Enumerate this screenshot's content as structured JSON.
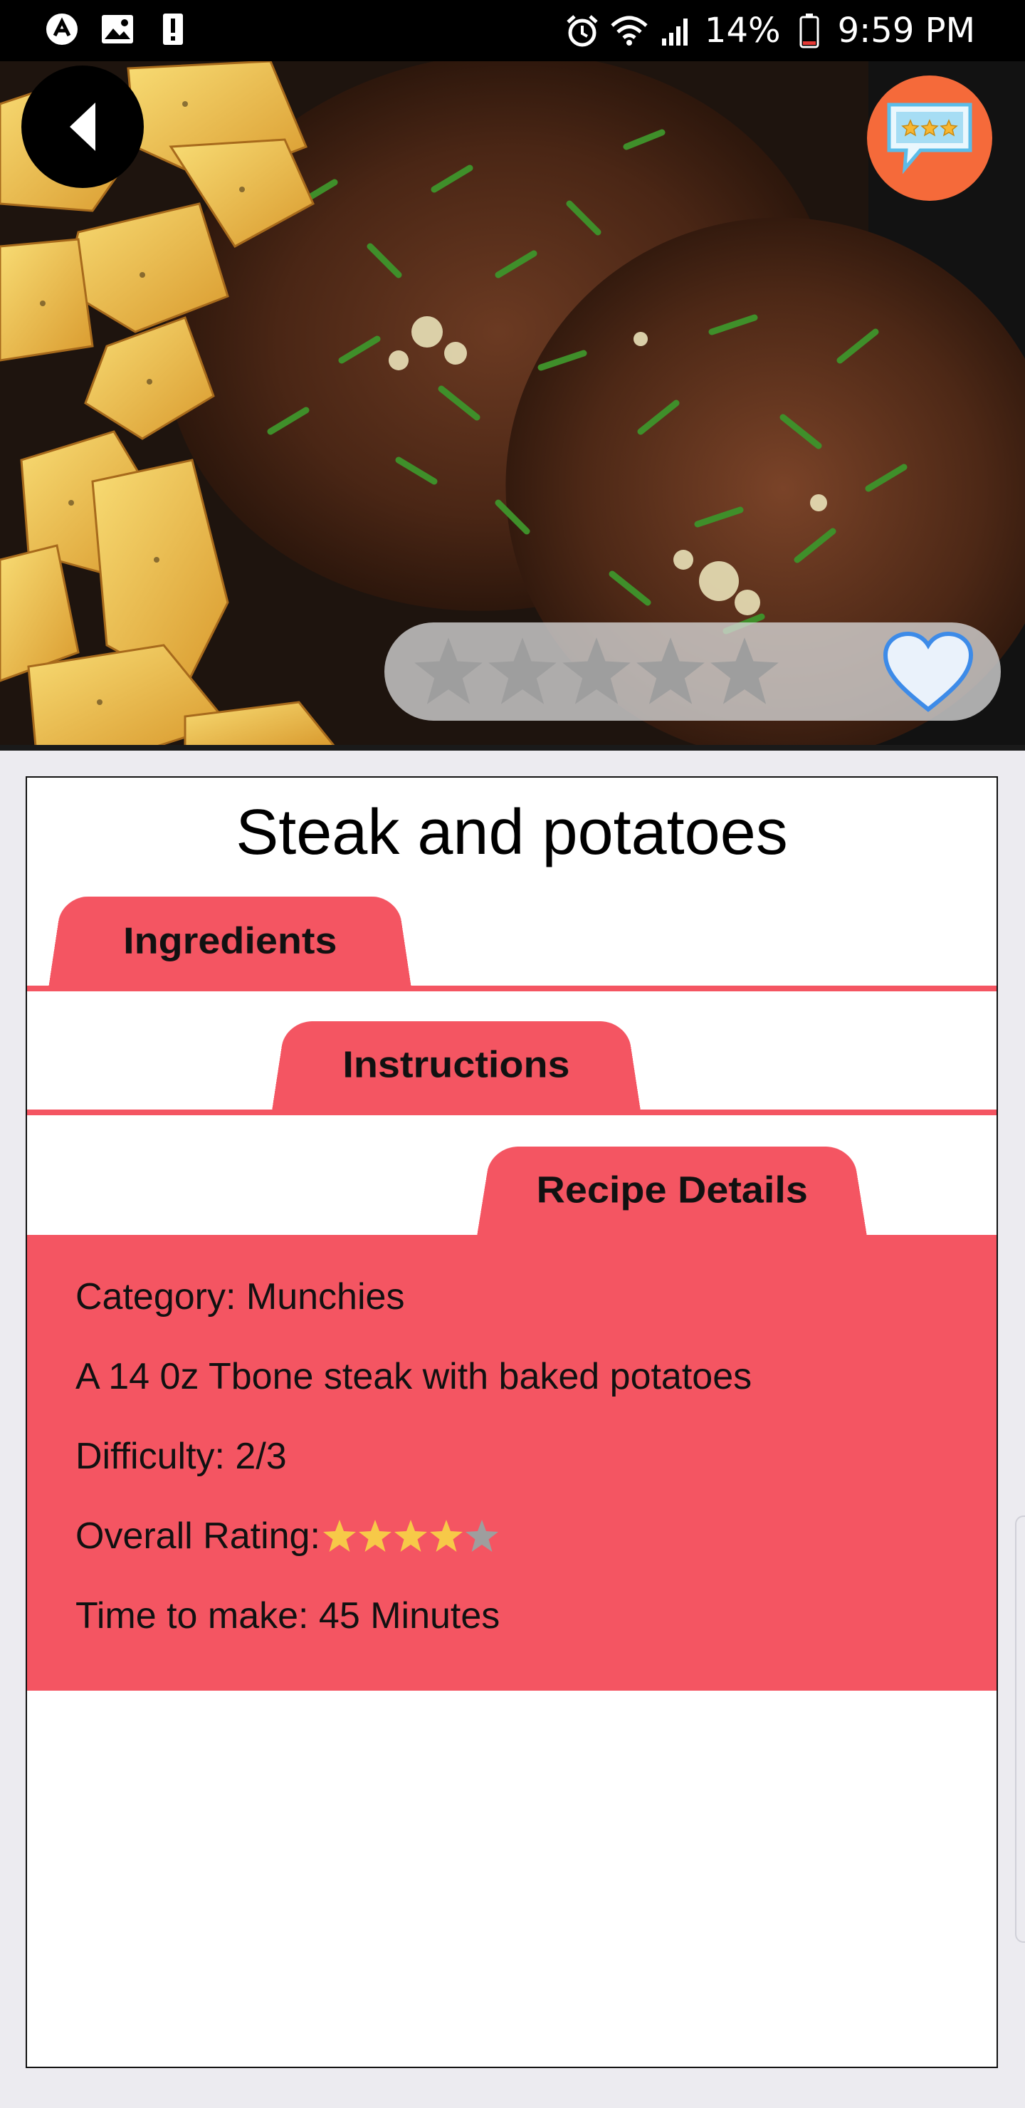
{
  "status_bar": {
    "left_icons": [
      "app-notification-icon",
      "image-notification-icon",
      "alert-notification-icon"
    ],
    "right_icons": [
      "alarm-icon",
      "wifi-icon",
      "signal-icon"
    ],
    "battery": "14%",
    "time": "9:59 PM"
  },
  "hero": {
    "image": "steak-and-potatoes-photo",
    "back_icon": "back-arrow-icon",
    "review_icon": "rating-review-icon",
    "user_rating": {
      "filled": 0,
      "total": 5
    },
    "favorite_icon": "heart-icon"
  },
  "recipe": {
    "title": "Steak and potatoes"
  },
  "tabs": {
    "ingredients": "Ingredients",
    "instructions": "Instructions",
    "details": "Recipe Details"
  },
  "details": {
    "category": "Category: Munchies",
    "description": "A 14 0z Tbone steak with baked potatoes",
    "difficulty": "Difficulty: 2/3",
    "rating_label": "Overall Rating:",
    "overall_rating": {
      "filled": 4,
      "total": 5
    },
    "time": "Time to make: 45 Minutes"
  },
  "colors": {
    "accent": "#F45562",
    "review_badge": "#F56A3A",
    "star_filled": "#F7C948",
    "star_empty": "#9E9E9E",
    "heart_fill": "#EAF2FB",
    "heart_stroke": "#3D8BE8"
  }
}
